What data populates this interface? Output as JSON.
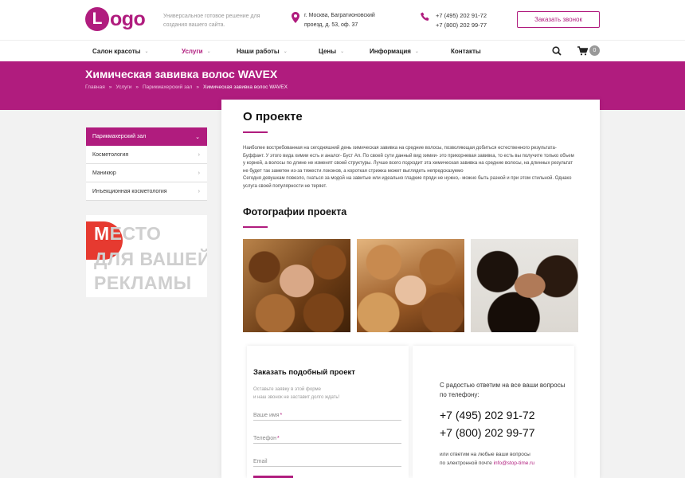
{
  "header": {
    "logo_letter": "L",
    "logo_text": "ogo",
    "tagline": "Универсальное готовое решение для создания вашего сайта.",
    "address_line1": "г. Москва, Багратионовский",
    "address_line2": "проезд, д. 53, оф. 37",
    "phone1": "+7 (495) 202 91-72",
    "phone2": "+7 (800) 202 99-77",
    "callback_label": "Заказать звонок",
    "icons": [
      "map-pin-icon",
      "phone-icon"
    ]
  },
  "nav": {
    "items": [
      {
        "label": "Салон красоты",
        "chevron": "⌄"
      },
      {
        "label": "Услуги",
        "chevron": "⌄"
      },
      {
        "label": "Наши работы",
        "chevron": "⌄"
      },
      {
        "label": "Цены",
        "chevron": "⌄"
      },
      {
        "label": "Информация",
        "chevron": "⌄"
      },
      {
        "label": "Контакты",
        "chevron": ""
      }
    ],
    "active_index": 1,
    "cart_count": "0",
    "icons": [
      "search-icon",
      "cart-icon"
    ]
  },
  "banner": {
    "title": "Химическая завивка волос WAVEX",
    "breadcrumb": [
      "Главная",
      "Услуги",
      "Парикмахерский зал",
      "Химическая завивка волос WAVEX"
    ],
    "separator": "»"
  },
  "sidebar": {
    "items": [
      {
        "label": "Парикмахерский зал",
        "arrow": "⌄"
      },
      {
        "label": "Косметология",
        "arrow": "›"
      },
      {
        "label": "Маникюр",
        "arrow": "›"
      },
      {
        "label": "Инъекционная косметология",
        "arrow": "›"
      }
    ],
    "active_index": 0
  },
  "ad": {
    "letter": "М",
    "line1_rest": "ЕСТО",
    "line2": "ДЛЯ ВАШЕЙ",
    "line3": "РЕКЛАМЫ"
  },
  "main": {
    "about_heading": "О проекте",
    "about_paragraph1": "Наиболее востребованная на сегодняшний день химическая завивка на средние волосы, позволяющая добиться естественного результата- Буффант. У этого вида химии есть и аналог- Буст Ап. По своей сути данный вид химии- это прикорневая завивка, то есть вы получите только объем у корней, а волосы по длине не изменят своей структуры. Лучше всего подходит эта химическая завивка на средние волосы, на длинных результат не будет так заметен из-за тяжести локонов, а короткая стрижка может выглядеть непредсказуемо",
    "about_paragraph2": "Сегодня девушкам повезло, гнаться за модой на завитые или идеально гладкие пряди не нужно,- можно быть разной и при этом стильной. Однако услуга своей популярности не теряет.",
    "photos_heading": "Фотографии проекта",
    "photos": [
      {
        "name": "curly-hair-photo-1"
      },
      {
        "name": "curly-hair-photo-2"
      },
      {
        "name": "curly-hair-photo-3"
      }
    ]
  },
  "order_form": {
    "title": "Заказать подобный проект",
    "note_line1": "Оставьте заявку в этой форме",
    "note_line2": "и наш звонок не заставит долго ждать!",
    "fields": [
      {
        "label": "Ваше имя",
        "required": "*"
      },
      {
        "label": "Телефон",
        "required": "*"
      },
      {
        "label": "Email",
        "required": ""
      }
    ]
  },
  "contact_info": {
    "text1": "С радостью ответим на все ваши вопросы по телефону:",
    "phone1": "+7 (495) 202 91-72",
    "phone2": "+7 (800) 202 99-77",
    "text2_line1": "или ответим на любые ваши вопросы",
    "text2_line2_prefix": "по электронной почте ",
    "email": "info@stop-time.ru"
  },
  "colors": {
    "accent": "#b01c7e",
    "background_gray": "#f2f2f2",
    "ad_red": "#e63a30"
  }
}
